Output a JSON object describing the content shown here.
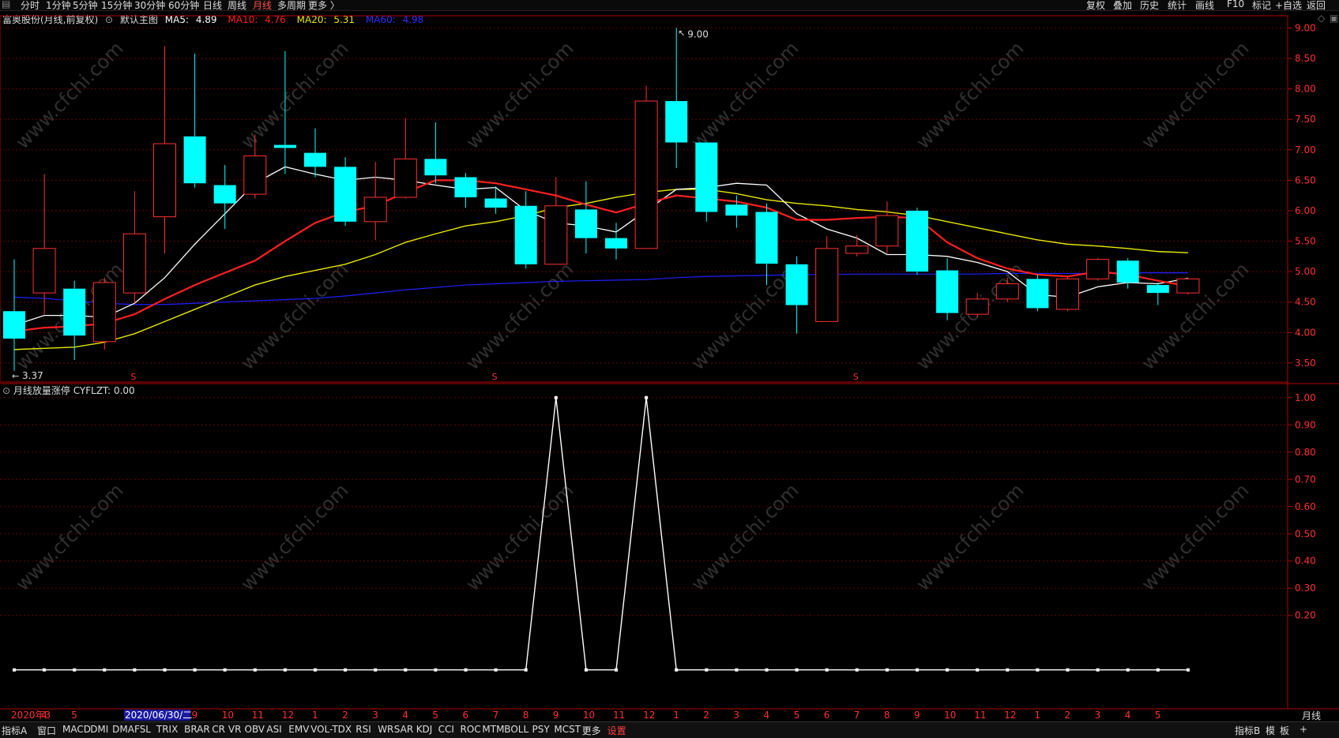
{
  "topbar": {
    "left_tabs": [
      "分时",
      "1分钟",
      "5分钟",
      "15分钟",
      "30分钟",
      "60分钟",
      "日线",
      "周线",
      "月线",
      "多周期",
      "更多 〉"
    ],
    "active_tab": "月线",
    "right_tabs": [
      "复权",
      "叠加",
      "历史",
      "统计",
      "画线",
      "F10",
      "标记",
      "+自选",
      "返回"
    ]
  },
  "main_chart": {
    "stock_title": "富奥股份(月线,前复权)",
    "view_name": "默认主图",
    "ma": [
      {
        "label": "MA5:",
        "value": "4.89",
        "color": "#ffffff"
      },
      {
        "label": "MA10:",
        "value": "4.76",
        "color": "#ff2020"
      },
      {
        "label": "MA20:",
        "value": "5.31",
        "color": "#e8e800"
      },
      {
        "label": "MA60:",
        "value": "4.98",
        "color": "#2020ff"
      }
    ],
    "high_label": "9.00",
    "low_label": "3.37",
    "price_ticks": [
      "9.00",
      "8.50",
      "8.00",
      "7.50",
      "7.00",
      "6.50",
      "6.00",
      "5.50",
      "5.00",
      "4.50",
      "4.00",
      "3.50"
    ],
    "s_marker": "S"
  },
  "sub_chart": {
    "indicator": "月线放量涨停",
    "field": "CYFLZT:",
    "value": "0.00",
    "ticks": [
      "1.00",
      "0.90",
      "0.80",
      "0.70",
      "0.60",
      "0.50",
      "0.40",
      "0.30",
      "0.20"
    ]
  },
  "xaxis": {
    "labels": [
      "2020年3",
      "4",
      "5",
      "",
      "7",
      "8",
      "9",
      "10",
      "11",
      "12",
      "1",
      "2",
      "3",
      "4",
      "5",
      "6",
      "7",
      "8",
      "9",
      "10",
      "11",
      "12",
      "1",
      "2",
      "3",
      "4",
      "5",
      "6",
      "7",
      "8",
      "9",
      "10",
      "11",
      "12",
      "1",
      "2",
      "3",
      "4",
      "5"
    ],
    "cursor_date": "2020/06/30/二",
    "period": "月线"
  },
  "bottombar": {
    "tabs": [
      "指标A",
      "窗口",
      "MACD",
      "DMI",
      "DMA",
      "FSL",
      "TRIX",
      "BRAR",
      "CR",
      "VR",
      "OBV",
      "ASI",
      "EMV",
      "VOL-TDX",
      "RSI",
      "WR",
      "SAR",
      "KDJ",
      "CCI",
      "ROC",
      "MTM",
      "BOLL",
      "PSY",
      "MCST",
      "更多",
      "设置"
    ],
    "right": [
      "指标B",
      "模",
      "板",
      "+"
    ]
  },
  "watermark": "www.cfchi.com",
  "colors": {
    "up": "#ff3030",
    "down": "#00ffff",
    "ma5": "#ffffff",
    "ma10": "#ff2020",
    "ma20": "#e8e800",
    "ma60": "#2020ff",
    "grid": "#6b0000",
    "axis": "#b00000"
  },
  "chart_data": {
    "type": "candlestick",
    "candles": [
      {
        "o": 4.35,
        "c": 3.9,
        "h": 5.2,
        "l": 3.37
      },
      {
        "o": 4.65,
        "c": 5.38,
        "h": 6.6,
        "l": 4.3
      },
      {
        "o": 4.72,
        "c": 3.95,
        "h": 4.85,
        "l": 3.55
      },
      {
        "o": 3.85,
        "c": 4.82,
        "h": 4.9,
        "l": 3.72
      },
      {
        "o": 4.65,
        "c": 5.62,
        "h": 6.32,
        "l": 4.48
      },
      {
        "o": 5.9,
        "c": 7.1,
        "h": 8.7,
        "l": 5.3
      },
      {
        "o": 7.22,
        "c": 6.45,
        "h": 8.58,
        "l": 6.38
      },
      {
        "o": 6.42,
        "c": 6.12,
        "h": 6.75,
        "l": 5.7
      },
      {
        "o": 6.27,
        "c": 6.9,
        "h": 7.25,
        "l": 6.2
      },
      {
        "o": 7.08,
        "c": 7.03,
        "h": 8.62,
        "l": 6.6
      },
      {
        "o": 6.95,
        "c": 6.72,
        "h": 7.35,
        "l": 6.55
      },
      {
        "o": 6.72,
        "c": 5.82,
        "h": 6.88,
        "l": 5.75
      },
      {
        "o": 5.82,
        "c": 6.22,
        "h": 6.8,
        "l": 5.52
      },
      {
        "o": 6.22,
        "c": 6.85,
        "h": 7.52,
        "l": 6.2
      },
      {
        "o": 6.85,
        "c": 6.58,
        "h": 7.45,
        "l": 6.45
      },
      {
        "o": 6.55,
        "c": 6.22,
        "h": 6.62,
        "l": 6.05
      },
      {
        "o": 6.2,
        "c": 6.05,
        "h": 6.4,
        "l": 5.95
      },
      {
        "o": 6.08,
        "c": 5.12,
        "h": 6.32,
        "l": 5.05
      },
      {
        "o": 5.12,
        "c": 6.08,
        "h": 6.55,
        "l": 5.12
      },
      {
        "o": 6.02,
        "c": 5.55,
        "h": 6.48,
        "l": 5.3
      },
      {
        "o": 5.55,
        "c": 5.38,
        "h": 5.8,
        "l": 5.2
      },
      {
        "o": 5.38,
        "c": 7.8,
        "h": 8.05,
        "l": 5.38
      },
      {
        "o": 7.8,
        "c": 7.12,
        "h": 9.0,
        "l": 6.7
      },
      {
        "o": 7.12,
        "c": 5.98,
        "h": 7.12,
        "l": 5.82
      },
      {
        "o": 6.1,
        "c": 5.92,
        "h": 6.25,
        "l": 5.72
      },
      {
        "o": 5.98,
        "c": 5.13,
        "h": 6.12,
        "l": 4.78
      },
      {
        "o": 5.12,
        "c": 4.45,
        "h": 5.25,
        "l": 3.98
      },
      {
        "o": 4.18,
        "c": 5.38,
        "h": 5.58,
        "l": 4.18
      },
      {
        "o": 5.3,
        "c": 5.42,
        "h": 5.6,
        "l": 5.25
      },
      {
        "o": 5.42,
        "c": 5.92,
        "h": 6.15,
        "l": 5.3
      },
      {
        "o": 6.0,
        "c": 5.0,
        "h": 6.05,
        "l": 4.95
      },
      {
        "o": 5.02,
        "c": 4.32,
        "h": 5.22,
        "l": 4.2
      },
      {
        "o": 4.3,
        "c": 4.55,
        "h": 4.65,
        "l": 4.25
      },
      {
        "o": 4.55,
        "c": 4.8,
        "h": 4.9,
        "l": 4.5
      },
      {
        "o": 4.88,
        "c": 4.4,
        "h": 4.95,
        "l": 4.35
      },
      {
        "o": 4.38,
        "c": 4.88,
        "h": 4.92,
        "l": 4.35
      },
      {
        "o": 4.88,
        "c": 5.2,
        "h": 5.22,
        "l": 4.85
      },
      {
        "o": 5.18,
        "c": 4.82,
        "h": 5.22,
        "l": 4.72
      },
      {
        "o": 4.78,
        "c": 4.65,
        "h": 4.82,
        "l": 4.45
      },
      {
        "o": 4.65,
        "c": 4.88,
        "h": 4.9,
        "l": 4.62
      }
    ],
    "ma5": [
      4.12,
      4.28,
      4.28,
      4.25,
      4.48,
      4.9,
      5.45,
      5.95,
      6.45,
      6.72,
      6.6,
      6.5,
      6.55,
      6.5,
      6.42,
      6.35,
      6.38,
      6.0,
      5.8,
      5.75,
      5.65,
      6.0,
      6.35,
      6.38,
      6.45,
      6.42,
      5.95,
      5.7,
      5.55,
      5.28,
      5.28,
      5.25,
      5.15,
      5.0,
      4.62,
      4.58,
      4.75,
      4.82,
      4.8,
      4.89
    ],
    "ma10": [
      4.02,
      4.08,
      4.1,
      4.15,
      4.3,
      4.55,
      4.78,
      4.98,
      5.18,
      5.5,
      5.8,
      5.98,
      6.08,
      6.3,
      6.5,
      6.5,
      6.45,
      6.35,
      6.25,
      6.1,
      5.97,
      6.12,
      6.25,
      6.2,
      6.15,
      6.05,
      5.85,
      5.85,
      5.88,
      5.9,
      5.88,
      5.48,
      5.22,
      5.05,
      4.95,
      4.92,
      5.0,
      4.95,
      4.85,
      4.76
    ],
    "ma20": [
      3.72,
      3.74,
      3.76,
      3.84,
      3.98,
      4.18,
      4.38,
      4.58,
      4.78,
      4.92,
      5.02,
      5.12,
      5.28,
      5.48,
      5.62,
      5.75,
      5.82,
      5.92,
      6.05,
      6.12,
      6.22,
      6.3,
      6.35,
      6.35,
      6.28,
      6.18,
      6.12,
      6.08,
      6.02,
      5.98,
      5.92,
      5.82,
      5.72,
      5.62,
      5.52,
      5.45,
      5.42,
      5.38,
      5.33,
      5.31
    ],
    "ma60": [
      4.58,
      4.56,
      4.52,
      4.48,
      4.46,
      4.46,
      4.48,
      4.5,
      4.52,
      4.54,
      4.56,
      4.6,
      4.65,
      4.7,
      4.74,
      4.78,
      4.8,
      4.82,
      4.84,
      4.85,
      4.86,
      4.87,
      4.9,
      4.92,
      4.93,
      4.94,
      4.95,
      4.95,
      4.96,
      4.96,
      4.96,
      4.96,
      4.96,
      4.97,
      4.97,
      4.97,
      4.97,
      4.98,
      4.98,
      4.98
    ],
    "indicator_values": [
      0,
      0,
      0,
      0,
      0,
      0,
      0,
      0,
      0,
      0,
      0,
      0,
      0,
      0,
      0,
      0,
      0,
      0,
      1,
      0,
      0,
      1,
      0,
      0,
      0,
      0,
      0,
      0,
      0,
      0,
      0,
      0,
      0,
      0,
      0,
      0,
      0,
      0,
      0,
      0
    ],
    "price_range": [
      3.2,
      9.2
    ],
    "indicator_range": [
      0,
      1.0
    ]
  }
}
